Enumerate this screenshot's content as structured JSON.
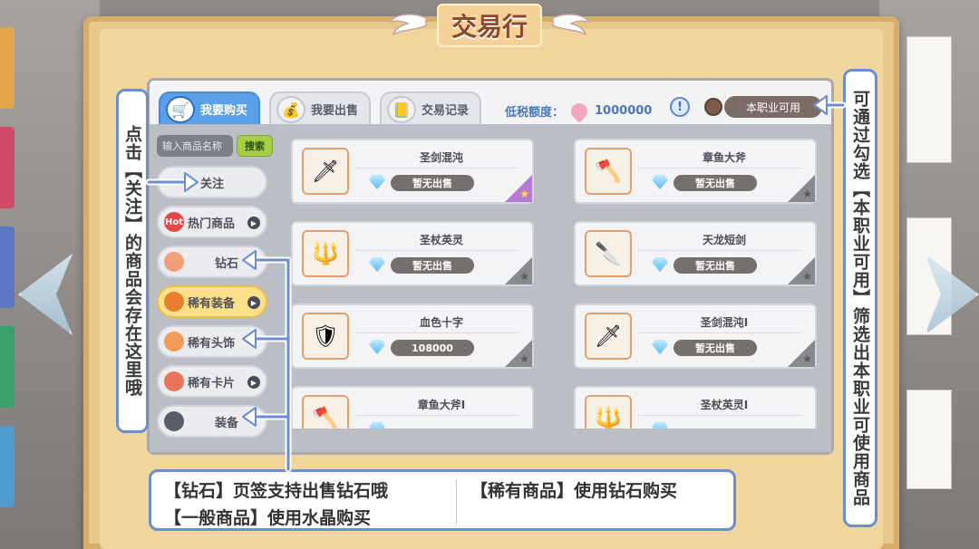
{
  "header": {
    "title": "交易行"
  },
  "tabs": [
    {
      "label": "我要购买",
      "icon": "shopping-cart-icon"
    },
    {
      "label": "我要出售",
      "icon": "money-bag-icon"
    },
    {
      "label": "交易记录",
      "icon": "record-book-icon"
    }
  ],
  "tax": {
    "label": "低税额度：",
    "value": "1000000"
  },
  "filter": {
    "label": "本职业可用"
  },
  "search": {
    "placeholder": "输入商品名称",
    "button": "搜索"
  },
  "categories": [
    {
      "label": "关注"
    },
    {
      "label": "热门商品",
      "icon_text": "Hot"
    },
    {
      "label": "钻石"
    },
    {
      "label": "稀有装备"
    },
    {
      "label": "稀有头饰"
    },
    {
      "label": "稀有卡片"
    },
    {
      "label": "装备"
    }
  ],
  "items": [
    {
      "name": "圣剑混沌",
      "price": "暂无出售",
      "star": "gold-star-icon"
    },
    {
      "name": "章鱼大斧",
      "price": "暂无出售",
      "star": "gray-star-icon"
    },
    {
      "name": "圣杖英灵",
      "price": "暂无出售",
      "star": "gray-star-icon"
    },
    {
      "name": "天龙短剑",
      "price": "暂无出售",
      "star": "gray-star-icon"
    },
    {
      "name": "血色十字",
      "price": "108000",
      "star": "gray-star-icon"
    },
    {
      "name": "圣剑混沌Ⅰ",
      "price": "暂无出售",
      "star": "gray-star-icon"
    },
    {
      "name": "章鱼大斧Ⅰ",
      "price": "",
      "star": ""
    },
    {
      "name": "圣杖英灵Ⅰ",
      "price": "",
      "star": ""
    }
  ],
  "annotations": {
    "left": "点击【关注】的商品会存在这里哦",
    "right": "可通过勾选【本职业可用】筛选出本职业可使用商品",
    "bottom_1": "【钻石】页签支持出售钻石哦",
    "bottom_2": "【一般商品】使用水晶购买",
    "bottom_3": "【稀有商品】使用钻石购买"
  },
  "colors": {
    "accent": "#5aa0e8",
    "annotation_border": "#6a8ed0",
    "paper": "#e8c98d"
  }
}
